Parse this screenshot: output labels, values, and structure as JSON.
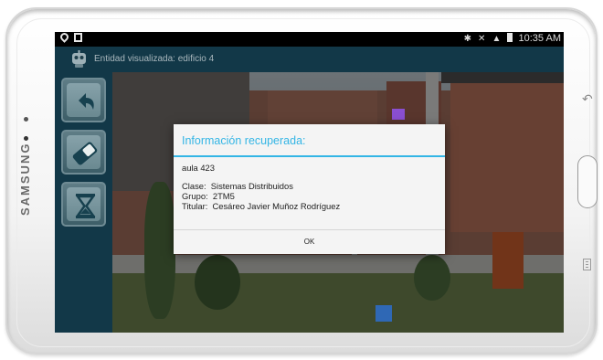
{
  "device": {
    "brand": "SAMSUNG",
    "icons": [
      "camera-icon",
      "light-sensor-icon",
      "back-key-icon",
      "home-button",
      "menu-key-icon"
    ]
  },
  "statusbar": {
    "left_icons": [
      "location-pin-icon",
      "sim-card-icon"
    ],
    "right_icons": [
      "bluetooth-icon",
      "mute-icon",
      "wifi-icon",
      "battery-icon"
    ],
    "time": "10:35 AM"
  },
  "appbar": {
    "title": "Entidad visualizada: edificio 4",
    "icon": "app-robot-icon"
  },
  "sidebar": {
    "buttons": [
      {
        "name": "undo-button",
        "icon": "undo-arrow-icon"
      },
      {
        "name": "eraser-button",
        "icon": "eraser-icon"
      },
      {
        "name": "hourglass-button",
        "icon": "hourglass-icon"
      }
    ]
  },
  "dialog": {
    "title": "Información recuperada:",
    "room": "aula 423",
    "lines": [
      "Clase:  Sistemas Distribuidos",
      "Grupo:  2TM5",
      "Titular:  Cesáreo Javier Muñoz Rodríguez"
    ],
    "ok_label": "OK"
  },
  "colors": {
    "accent": "#33b5e5",
    "appbar": "#123848",
    "dialog_bg": "#f4f4f4"
  }
}
